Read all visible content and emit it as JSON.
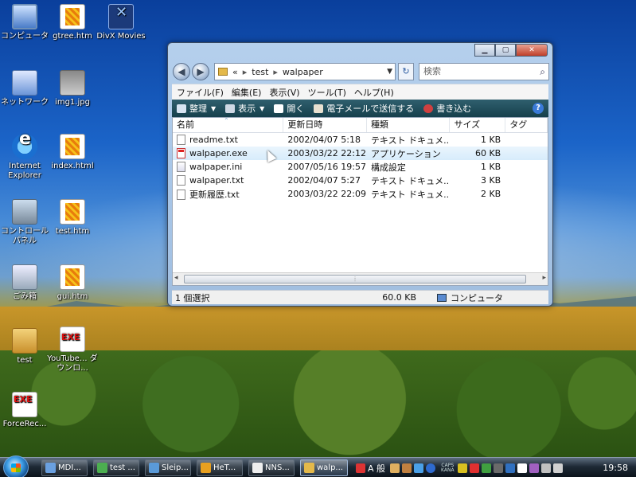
{
  "desktop": {
    "icons": [
      {
        "label": "コンピュータ"
      },
      {
        "label": "gtree.htm"
      },
      {
        "label": "DivX Movies"
      },
      {
        "label": "ネットワーク"
      },
      {
        "label": "img1.jpg"
      },
      {
        "label": "Internet Explorer"
      },
      {
        "label": "index.html"
      },
      {
        "label": "コントロール パネル"
      },
      {
        "label": "test.htm"
      },
      {
        "label": "ごみ箱"
      },
      {
        "label": "gui.htm"
      },
      {
        "label": "test"
      },
      {
        "label": "YouTube... ダウンロ..."
      },
      {
        "label": "ForceRec..."
      }
    ]
  },
  "window": {
    "address": {
      "prefix": "«",
      "crumb1": "test",
      "crumb2": "walpaper"
    },
    "search_placeholder": "検索",
    "menu": [
      "ファイル(F)",
      "編集(E)",
      "表示(V)",
      "ツール(T)",
      "ヘルプ(H)"
    ],
    "toolbar": {
      "organize": "整理",
      "views": "表示",
      "open": "開く",
      "email": "電子メールで送信する",
      "burn": "書き込む"
    },
    "columns": [
      "名前",
      "更新日時",
      "種類",
      "サイズ",
      "タグ"
    ],
    "files": [
      {
        "name": "readme.txt",
        "date": "2002/04/07 5:18",
        "type": "テキスト ドキュメ...",
        "size": "1 KB"
      },
      {
        "name": "walpaper.exe",
        "date": "2003/03/22 22:12",
        "type": "アプリケーション",
        "size": "60 KB"
      },
      {
        "name": "walpaper.ini",
        "date": "2007/05/16 19:57",
        "type": "構成設定",
        "size": "1 KB"
      },
      {
        "name": "walpaper.txt",
        "date": "2002/04/07 5:27",
        "type": "テキスト ドキュメ...",
        "size": "3 KB"
      },
      {
        "name": "更新履歴.txt",
        "date": "2003/03/22 22:09",
        "type": "テキスト ドキュメ...",
        "size": "2 KB"
      }
    ],
    "status": {
      "selected": "1 個選択",
      "size": "60.0 KB",
      "location": "コンピュータ"
    }
  },
  "taskbar": {
    "buttons": [
      "MDI...",
      "test ...",
      "Sleip...",
      "HeT...",
      "NNS...",
      "walp..."
    ],
    "tray": {
      "ime": "A 般",
      "caps": "CAPS",
      "kana": "KANA"
    },
    "clock": "19:58"
  }
}
